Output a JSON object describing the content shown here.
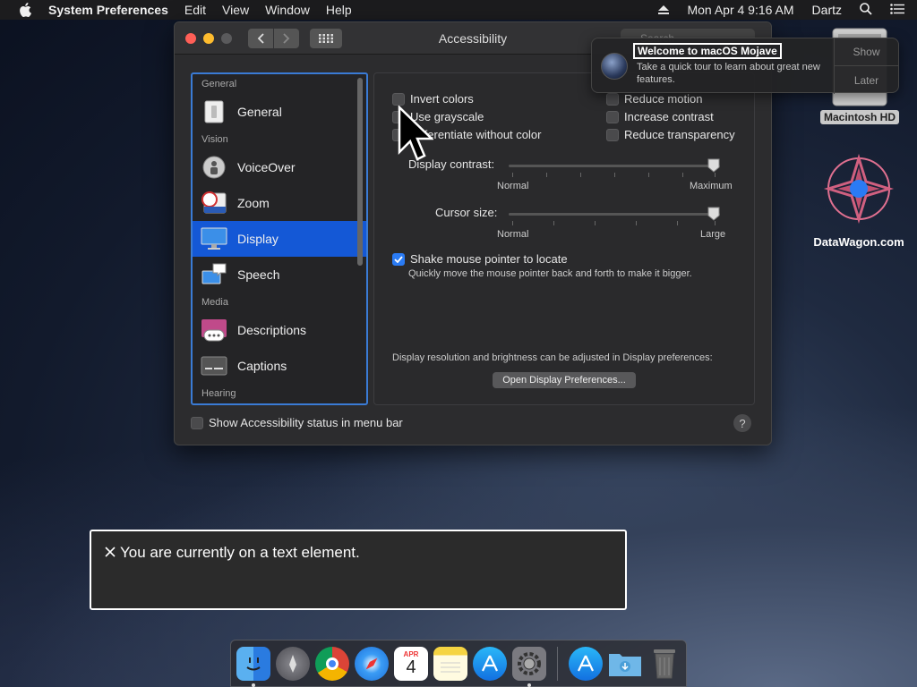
{
  "menubar": {
    "app_name": "System Preferences",
    "menus": [
      "Edit",
      "View",
      "Window",
      "Help"
    ],
    "clock": "Mon Apr 4  9:16 AM",
    "user": "Dartz"
  },
  "window": {
    "title": "Accessibility",
    "search_placeholder": "Search",
    "sidebar": [
      {
        "type": "section",
        "label": "General"
      },
      {
        "type": "item",
        "label": "General",
        "icon": "switch-icon",
        "selected": false
      },
      {
        "type": "section",
        "label": "Vision"
      },
      {
        "type": "item",
        "label": "VoiceOver",
        "icon": "voiceover-icon",
        "selected": false
      },
      {
        "type": "item",
        "label": "Zoom",
        "icon": "zoom-icon",
        "selected": false
      },
      {
        "type": "item",
        "label": "Display",
        "icon": "display-icon",
        "selected": true
      },
      {
        "type": "item",
        "label": "Speech",
        "icon": "speech-icon",
        "selected": false
      },
      {
        "type": "section",
        "label": "Media"
      },
      {
        "type": "item",
        "label": "Descriptions",
        "icon": "descriptions-icon",
        "selected": false
      },
      {
        "type": "item",
        "label": "Captions",
        "icon": "captions-icon",
        "selected": false
      },
      {
        "type": "section",
        "label": "Hearing"
      }
    ],
    "pane": {
      "invert_colors": "Invert colors",
      "use_grayscale": "Use grayscale",
      "differentiate": "Differentiate without color",
      "reduce_motion": "Reduce motion",
      "increase_contrast": "Increase contrast",
      "reduce_transparency": "Reduce transparency",
      "display_contrast_label": "Display contrast:",
      "display_contrast_min": "Normal",
      "display_contrast_max": "Maximum",
      "display_contrast_value": 1.0,
      "cursor_size_label": "Cursor size:",
      "cursor_size_min": "Normal",
      "cursor_size_max": "Large",
      "cursor_size_value": 1.0,
      "shake_label": "Shake mouse pointer to locate",
      "shake_checked": true,
      "shake_help": "Quickly move the mouse pointer back and forth to make it bigger.",
      "resolution_note": "Display resolution and brightness can be adjusted in Display preferences:",
      "open_display_button": "Open Display Preferences..."
    },
    "footer_checkbox": "Show Accessibility status in menu bar",
    "help": "?"
  },
  "notification": {
    "title": "Welcome to macOS Mojave",
    "body": "Take a quick tour to learn about great new features.",
    "show": "Show",
    "later": "Later"
  },
  "desktop": {
    "hd_label": "Macintosh HD",
    "datawagon_label": "DataWagon.com"
  },
  "voiceover_caption": "You are currently on a text element.",
  "dock": {
    "apps": [
      "finder-icon",
      "launchpad-icon",
      "chrome-icon",
      "safari-icon",
      "calendar-icon",
      "notes-icon",
      "app-store-icon",
      "system-preferences-icon",
      "app-store-download-icon",
      "downloads-folder-icon",
      "trash-icon"
    ],
    "calendar_month": "APR",
    "calendar_day": "4"
  },
  "colors": {
    "accent": "#1458d6",
    "checkbox_checked": "#2a7bf4",
    "window_bg": "#2c2c2e"
  }
}
